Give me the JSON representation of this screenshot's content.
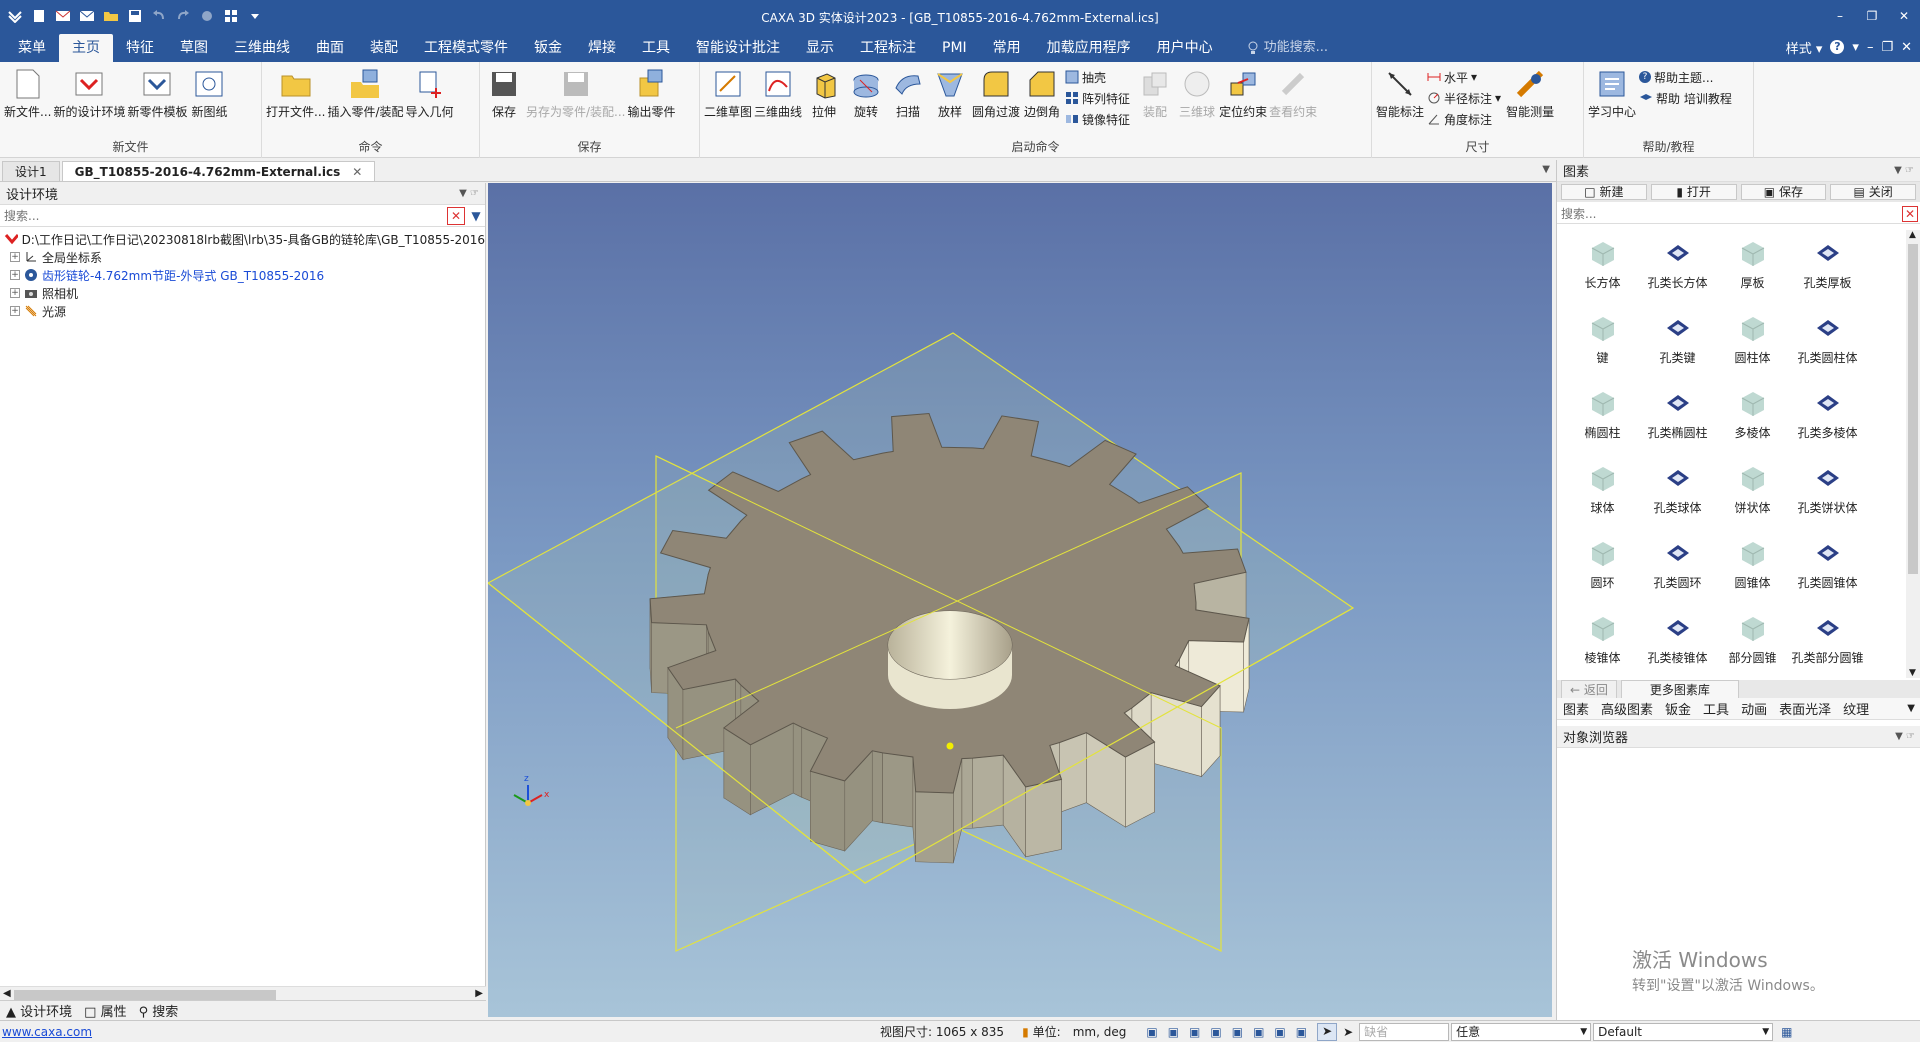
{
  "app": {
    "title": "CAXA 3D 实体设计2023 - [GB_T10855-2016-4.762mm-External.ics]"
  },
  "menu_tabs": [
    "菜单",
    "主页",
    "特征",
    "草图",
    "三维曲线",
    "曲面",
    "装配",
    "工程模式零件",
    "钣金",
    "焊接",
    "工具",
    "智能设计批注",
    "显示",
    "工程标注",
    "PMI",
    "常用",
    "加载应用程序",
    "用户中心"
  ],
  "feature_search": "功能搜索...",
  "style_label": "样式",
  "ribbon": {
    "g_newfile": {
      "label": "新文件",
      "items": [
        "新文件...",
        "新的设计环境",
        "新零件模板",
        "新图纸"
      ]
    },
    "g_command": {
      "label": "命令",
      "items": [
        "打开文件...",
        "插入零件/装配",
        "导入几何"
      ]
    },
    "g_save": {
      "label": "保存",
      "items": [
        "保存",
        "另存为零件/装配...",
        "输出零件"
      ]
    },
    "g_launch": {
      "label": "启动命令",
      "items": [
        "二维草图",
        "三维曲线",
        "拉伸",
        "旋转",
        "扫描",
        "放样",
        "圆角过渡",
        "边倒角"
      ],
      "small": [
        "抽壳",
        "阵列特征",
        "镜像特征"
      ],
      "disabled": [
        "装配",
        "三维球",
        "定位约束",
        "查看约束"
      ]
    },
    "g_dim": {
      "label": "尺寸",
      "big": "智能标注",
      "small": [
        "水平",
        "半径标注",
        "角度标注"
      ],
      "big2": "智能测量"
    },
    "g_help": {
      "label": "帮助/教程",
      "big": "学习中心",
      "small": [
        "帮助主题...",
        "帮助 培训教程"
      ]
    }
  },
  "doc_tabs": [
    "设计1",
    "GB_T10855-2016-4.762mm-External.ics"
  ],
  "left_panel": {
    "title": "设计环境",
    "search_placeholder": "搜索...",
    "tree": [
      "D:\\工作日记\\工作日记\\20230818lrb截图\\lrb\\35-具备GB的链轮库\\GB_T10855-2016",
      "全局坐标系",
      "齿形链轮-4.762mm节距-外导式 GB_T10855-2016",
      "照相机",
      "光源"
    ],
    "bottom_tabs": [
      "设计环境",
      "属性",
      "搜索"
    ]
  },
  "right_panel": {
    "title": "图素",
    "buttons": [
      "新建",
      "打开",
      "保存",
      "关闭"
    ],
    "search_placeholder": "搜索...",
    "shapes": [
      "长方体",
      "孔类长方体",
      "厚板",
      "孔类厚板",
      "键",
      "孔类键",
      "圆柱体",
      "孔类圆柱体",
      "椭圆柱",
      "孔类椭圆柱",
      "多棱体",
      "孔类多棱体",
      "球体",
      "孔类球体",
      "饼状体",
      "孔类饼状体",
      "圆环",
      "孔类圆环",
      "圆锥体",
      "孔类圆锥体",
      "棱锥体",
      "孔类棱锥体",
      "部分圆锥",
      "孔类部分圆锥"
    ],
    "nav": [
      "返回",
      "更多图素库"
    ],
    "tabs": [
      "图素",
      "高级图素",
      "钣金",
      "工具",
      "动画",
      "表面光泽",
      "纹理"
    ],
    "object_browser": "对象浏览器"
  },
  "viewport": {
    "triad_labels": [
      "z",
      "x"
    ]
  },
  "watermark": {
    "line1": "激活 Windows",
    "line2": "转到\"设置\"以激活 Windows。"
  },
  "status": {
    "url": "www.caxa.com",
    "view_size": "视图尺寸: 1065 x  835",
    "unit_label": "单位:",
    "unit_value": "mm, deg",
    "field1_placeholder": "缺省",
    "field2": "任意",
    "field3": "Default"
  },
  "colors": {
    "accent": "#2b579a",
    "gear": "#8f8676",
    "bbox": "#e3e33c"
  }
}
